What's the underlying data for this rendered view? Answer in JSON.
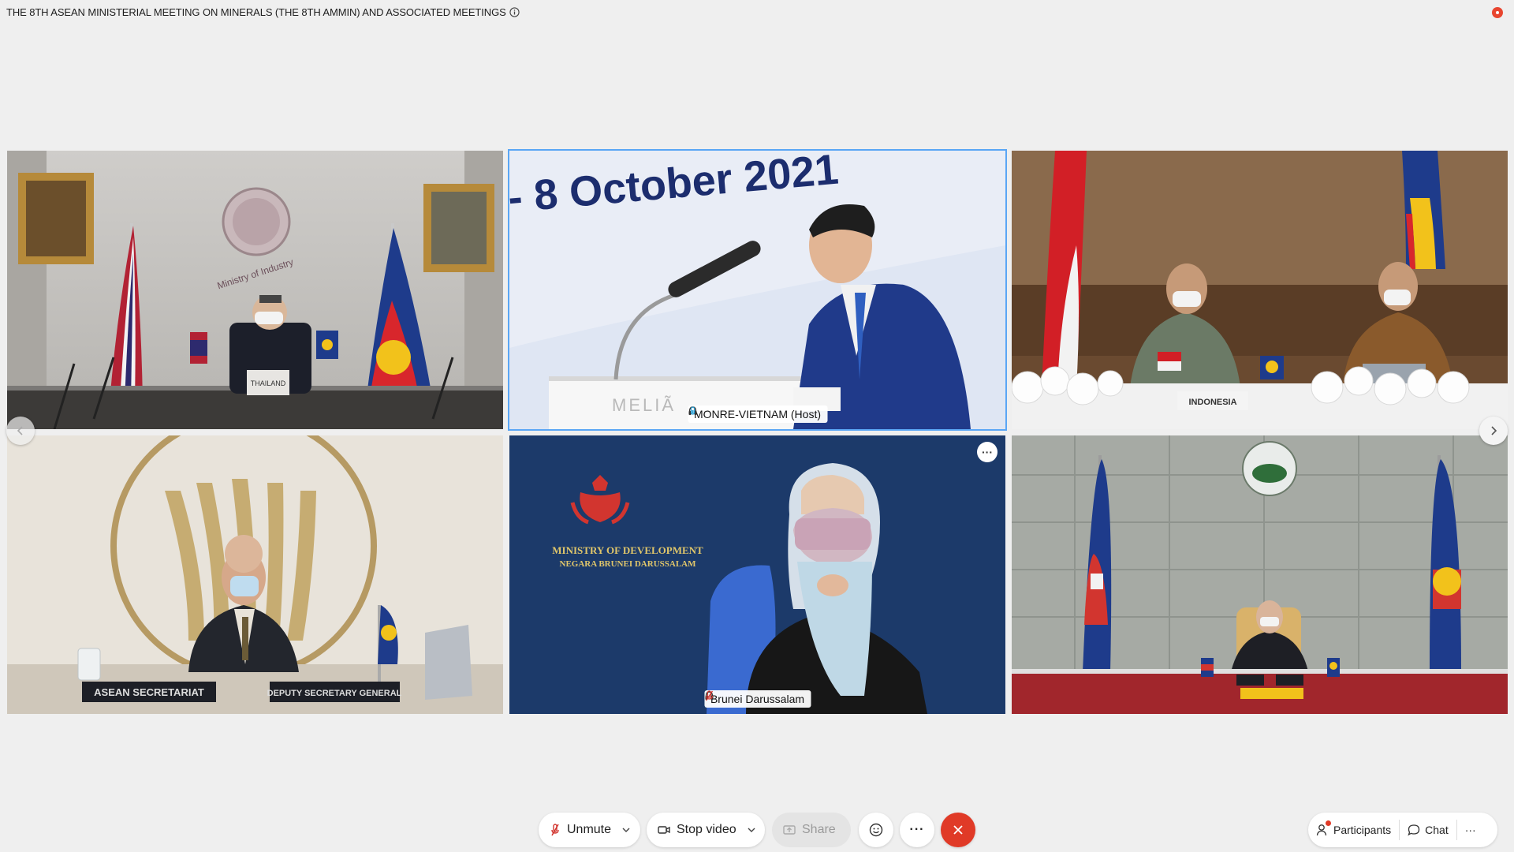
{
  "header": {
    "meeting_title": "THE 8TH ASEAN MINISTERIAL MEETING ON MINERALS (THE 8TH AMMIN) AND ASSOCIATED MEETINGS",
    "info_icon": "info-icon",
    "record_icon": "recording-indicator-icon",
    "record_color": "#e8452f"
  },
  "tiles": [
    {
      "id": "thailand",
      "name_tag": "",
      "placard": "THAILAND",
      "wall_text": "Ministry of Industry"
    },
    {
      "id": "vietnam-host",
      "name_tag": "MONRE-VIETNAM (Host)",
      "banner": "- 8 October 2021",
      "podium": "MELIÃ",
      "active_speaker": true,
      "highlight_color": "#5aa6f5"
    },
    {
      "id": "indonesia",
      "name_tag": "",
      "placard": "INDONESIA"
    },
    {
      "id": "asean-secretariat",
      "name_tag": "",
      "placard_left": "ASEAN SECRETARIAT",
      "placard_right": "DEPUTY SECRETARY GENERAL"
    },
    {
      "id": "brunei",
      "name_tag": "Brunei Darussalam",
      "backdrop_line1": "MINISTRY  OF DEVELOPMENT",
      "backdrop_line2": "NEGARA BRUNEI DARUSSALAM",
      "more_icon": "ellipsis-icon"
    },
    {
      "id": "cambodia",
      "name_tag": ""
    }
  ],
  "navigation": {
    "prev_icon": "chevron-left-icon",
    "next_icon": "chevron-right-icon"
  },
  "toolbar": {
    "unmute_label": "Unmute",
    "stop_video_label": "Stop video",
    "share_label": "Share",
    "reactions_icon": "smiley-icon",
    "more_label": "···",
    "leave_icon": "close-icon",
    "participants_label": "Participants",
    "chat_label": "Chat",
    "overflow_label": "···",
    "leave_color": "#e03a27"
  }
}
